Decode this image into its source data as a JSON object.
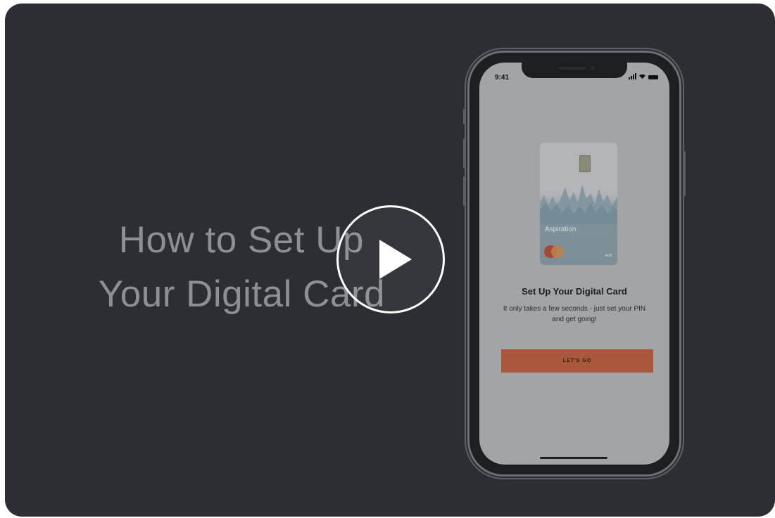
{
  "video": {
    "title_line1": "How to Set Up",
    "title_line2": "Your Digital Card",
    "play_icon": "play-icon"
  },
  "phone": {
    "status_time": "9:41",
    "card": {
      "brand": "Aspiration",
      "type_label": "debit",
      "network_icon": "mastercard-logo-icon"
    },
    "heading": "Set Up Your Digital Card",
    "description": "It only takes a few seconds - just set your PIN and get going!",
    "cta_label": "LET'S GO"
  },
  "colors": {
    "background": "#2c2e33",
    "title_text": "#8c8f94",
    "cta": "#a9583b",
    "play": "#ffffff"
  }
}
